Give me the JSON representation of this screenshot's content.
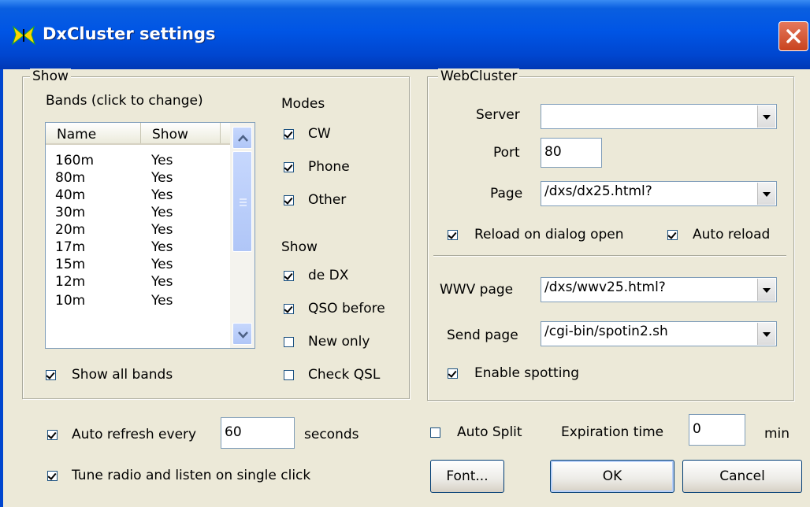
{
  "window": {
    "title": "DxCluster settings"
  },
  "show_group": {
    "legend": "Show",
    "bands_label": "Bands (click to change)",
    "columns": [
      "Name",
      "Show"
    ],
    "bands": [
      {
        "name": "160m",
        "show": "Yes"
      },
      {
        "name": "80m",
        "show": "Yes"
      },
      {
        "name": "40m",
        "show": "Yes"
      },
      {
        "name": "30m",
        "show": "Yes"
      },
      {
        "name": "20m",
        "show": "Yes"
      },
      {
        "name": "17m",
        "show": "Yes"
      },
      {
        "name": "15m",
        "show": "Yes"
      },
      {
        "name": "12m",
        "show": "Yes"
      },
      {
        "name": "10m",
        "show": "Yes"
      }
    ],
    "show_all_bands": {
      "label": "Show all bands",
      "checked": true
    },
    "modes_label": "Modes",
    "modes": [
      {
        "label": "CW",
        "checked": true
      },
      {
        "label": "Phone",
        "checked": true
      },
      {
        "label": "Other",
        "checked": true
      }
    ],
    "show_label": "Show",
    "show_options": [
      {
        "label": "de DX",
        "checked": true
      },
      {
        "label": "QSO before",
        "checked": true
      },
      {
        "label": "New only",
        "checked": false
      },
      {
        "label": "Check QSL",
        "checked": false
      }
    ]
  },
  "web_group": {
    "legend": "WebCluster",
    "server_label": "Server",
    "server_value": "",
    "port_label": "Port",
    "port_value": "80",
    "page_label": "Page",
    "page_value": "/dxs/dx25.html?",
    "reload_on_open": {
      "label": "Reload on dialog open",
      "checked": true
    },
    "auto_reload": {
      "label": "Auto reload",
      "checked": true
    },
    "wwv_label": "WWV page",
    "wwv_value": "/dxs/wwv25.html?",
    "send_label": "Send page",
    "send_value": "/cgi-bin/spotin2.sh",
    "enable_spotting": {
      "label": "Enable spotting",
      "checked": true
    }
  },
  "bottom": {
    "auto_refresh": {
      "label": "Auto refresh every",
      "checked": true
    },
    "refresh_value": "60",
    "seconds_label": "seconds",
    "tune_radio": {
      "label": "Tune radio and listen on single click",
      "checked": true
    },
    "auto_split": {
      "label": "Auto Split",
      "checked": false
    },
    "expiration_label": "Expiration time",
    "expiration_value": "0",
    "min_label": "min",
    "font_button": "Font...",
    "ok_button": "OK",
    "cancel_button": "Cancel"
  }
}
